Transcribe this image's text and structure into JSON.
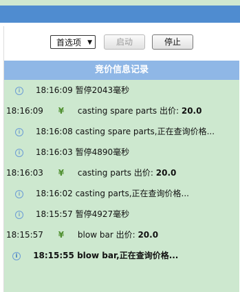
{
  "toolbar": {
    "select_value": "首选项",
    "start_label": "启动",
    "stop_label": "停止"
  },
  "header": {
    "title": "竞价信息记录"
  },
  "log": {
    "entries": [
      {
        "type": "info",
        "time": "18:16:09",
        "text": "暂停2043毫秒"
      },
      {
        "type": "price",
        "time": "18:16:09",
        "item": "casting spare parts",
        "price_label": "出价:",
        "price": "20.0"
      },
      {
        "type": "info",
        "time": "18:16:08",
        "text": "casting spare parts,正在查询价格..."
      },
      {
        "type": "info",
        "time": "18:16:03",
        "text": "暂停4890毫秒"
      },
      {
        "type": "price",
        "time": "18:16:03",
        "item": "casting parts",
        "price_label": "出价:",
        "price": "20.0"
      },
      {
        "type": "info",
        "time": "18:16:02",
        "text": "casting parts,正在查询价格..."
      },
      {
        "type": "info",
        "time": "18:15:57",
        "text": "暂停4927毫秒"
      },
      {
        "type": "price",
        "time": "18:15:57",
        "item": "blow bar",
        "price_label": "出价:",
        "price": "20.0"
      },
      {
        "type": "info-bold",
        "time": "18:15:55",
        "text": "blow bar,正在查询价格..."
      }
    ]
  }
}
